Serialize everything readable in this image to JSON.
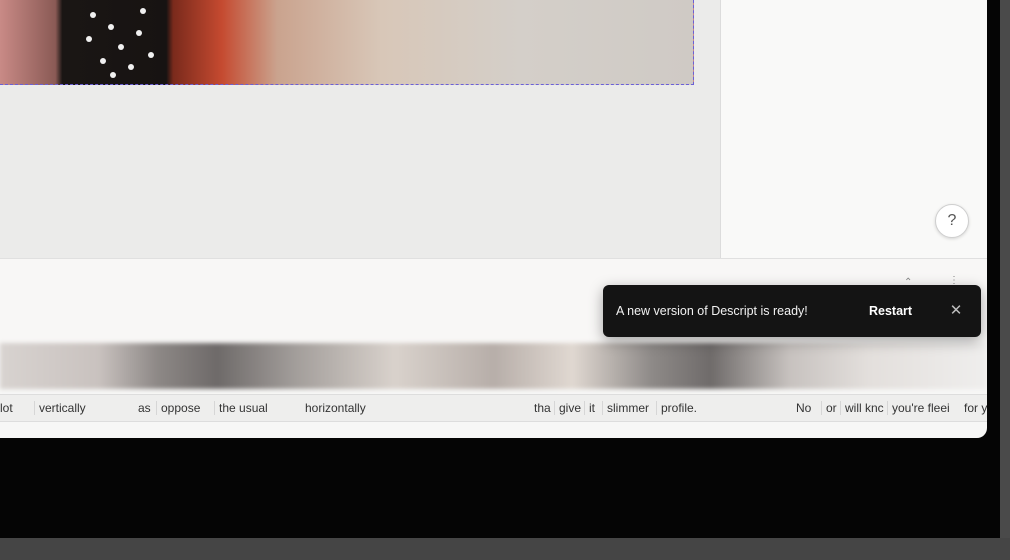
{
  "toast": {
    "message": "A new version of Descript is ready!",
    "restart_label": "Restart",
    "close_glyph": "✕",
    "close_icon": "close-icon"
  },
  "help": {
    "glyph": "?",
    "icon": "help-icon"
  },
  "toolbar": {
    "icons": [
      "chevron-up-icon",
      "more-icon"
    ]
  },
  "transcript": {
    "words": [
      "lot",
      "vertically",
      "as",
      "oppose",
      "the usual",
      "horizontally",
      "tha",
      "give",
      "it",
      "slimmer",
      "profile.",
      "No",
      "or",
      "will knc",
      "you're fleei",
      "for y"
    ]
  },
  "colors": {
    "selection_outline": "#6a5fd8",
    "toast_bg": "#141414"
  }
}
